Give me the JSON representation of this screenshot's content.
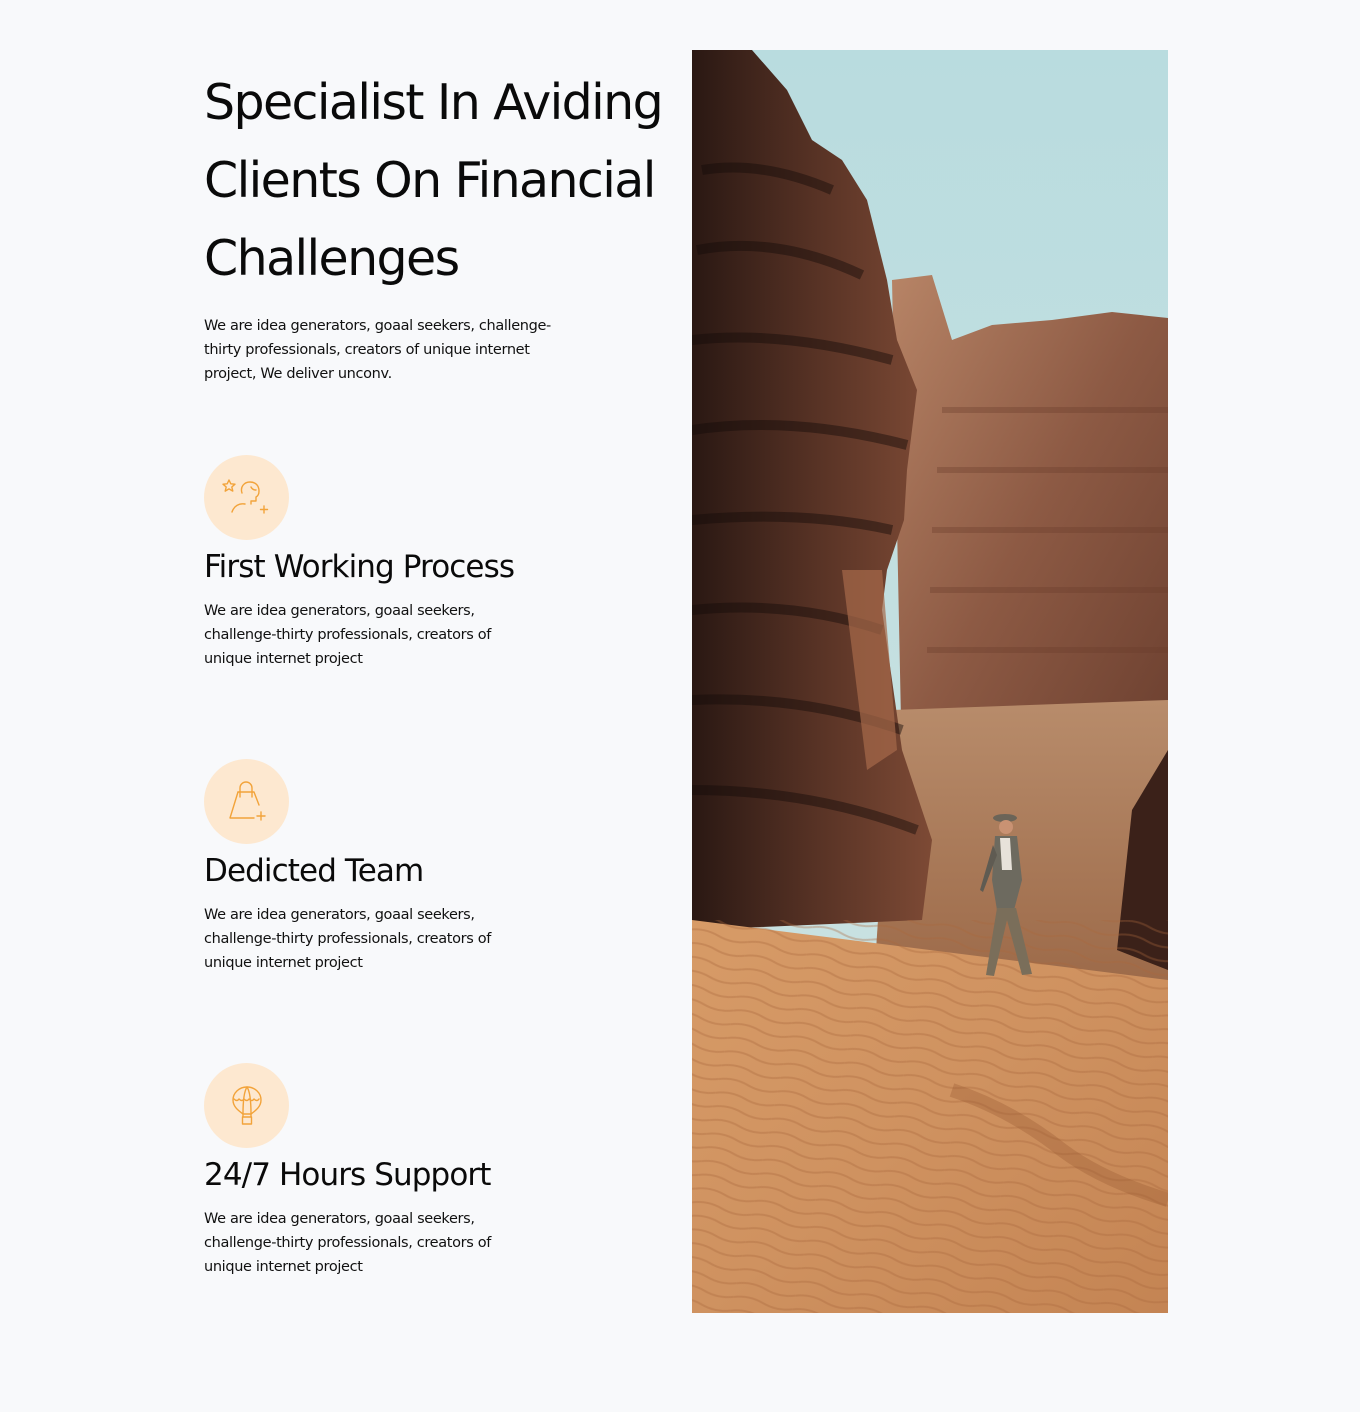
{
  "hero": {
    "headline": "Specialist In Aviding Clients On Financial Challenges",
    "intro": "We are idea generators, goaal seekers, challenge-thirty professionals, creators of unique internet project, We deliver unconv."
  },
  "features": [
    {
      "icon": "creative-person-star-icon",
      "title": "First Working Process",
      "description": "We are idea generators, goaal seekers, challenge-thirty professionals, creators of unique internet project"
    },
    {
      "icon": "shopping-bag-plus-icon",
      "title": "Dedicted Team",
      "description": "We are idea generators, goaal seekers, challenge-thirty professionals, creators of unique internet project"
    },
    {
      "icon": "hot-air-balloon-icon",
      "title": "24/7 Hours Support",
      "description": "We are idea generators, goaal seekers, challenge-thirty professionals, creators of unique internet project"
    }
  ],
  "colors": {
    "background": "#f8f9fb",
    "icon_circle": "#fde8d0",
    "icon_stroke": "#f2a33a",
    "text": "#0a0a0a"
  }
}
